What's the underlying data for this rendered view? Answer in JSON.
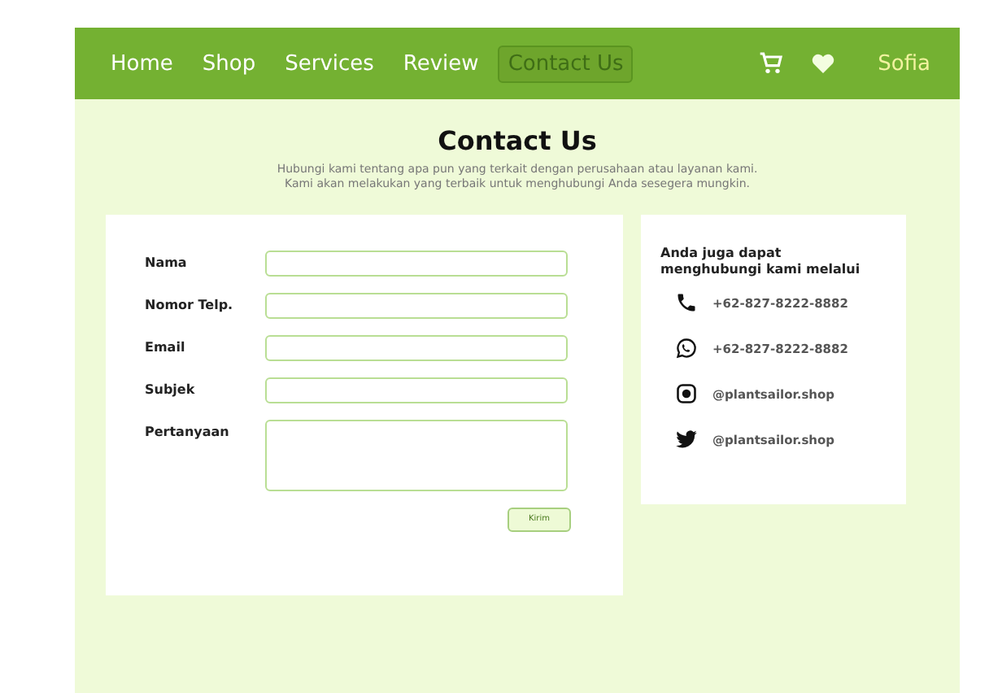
{
  "nav": {
    "items": [
      {
        "label": "Home",
        "selected": false
      },
      {
        "label": "Shop",
        "selected": false
      },
      {
        "label": "Services",
        "selected": false
      },
      {
        "label": "Review",
        "selected": false
      },
      {
        "label": "Contact Us",
        "selected": true
      }
    ],
    "user": "Sofia"
  },
  "heading": {
    "title": "Contact Us",
    "lines": [
      "Hubungi kami tentang apa pun yang terkait dengan perusahaan atau layanan kami.",
      "Kami akan melakukan yang terbaik untuk menghubungi Anda sesegera mungkin."
    ]
  },
  "form": {
    "fields": [
      {
        "label": "Nama",
        "kind": "text"
      },
      {
        "label": "Nomor Telp.",
        "kind": "text"
      },
      {
        "label": "Email",
        "kind": "text"
      },
      {
        "label": "Subjek",
        "kind": "text"
      },
      {
        "label": "Pertanyaan",
        "kind": "textarea"
      }
    ],
    "submit": "Kirim"
  },
  "contact": {
    "intro": "Anda juga dapat menghubungi kami melalui",
    "items": [
      {
        "kind": "phone",
        "text": "+62-827-8222-8882"
      },
      {
        "kind": "whatsapp",
        "text": "+62-827-8222-8882"
      },
      {
        "kind": "instagram",
        "text": "@plantsailor.shop"
      },
      {
        "kind": "twitter",
        "text": "@plantsailor.shop"
      }
    ]
  }
}
